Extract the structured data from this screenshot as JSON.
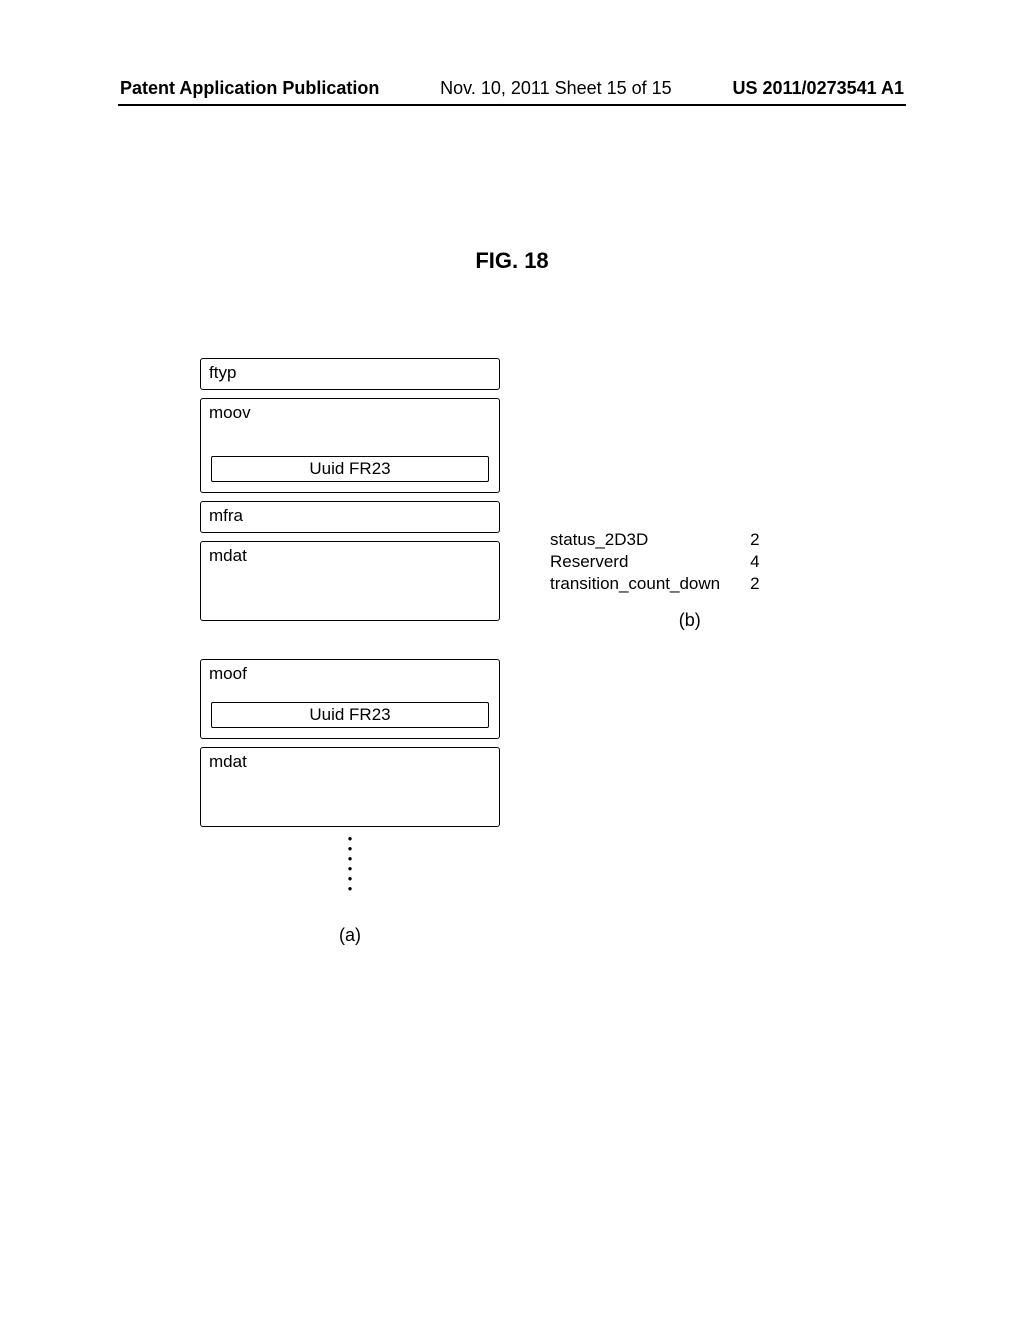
{
  "header": {
    "left": "Patent Application Publication",
    "center": "Nov. 10, 2011  Sheet 15 of 15",
    "right": "US 2011/0273541 A1"
  },
  "figure_title": "FIG. 18",
  "diagram_a": {
    "group1": {
      "ftyp": "ftyp",
      "moov": "moov",
      "moov_inner": "Uuid FR23",
      "mfra": "mfra",
      "mdat": "mdat"
    },
    "group2": {
      "moof": "moof",
      "moof_inner": "Uuid FR23",
      "mdat": "mdat"
    },
    "caption": "(a)"
  },
  "table_b": {
    "rows": [
      {
        "label": "status_2D3D",
        "value": "2"
      },
      {
        "label": "Reserverd",
        "value": "4"
      },
      {
        "label": "transition_count_down",
        "value": "2"
      }
    ],
    "caption": "(b)"
  }
}
